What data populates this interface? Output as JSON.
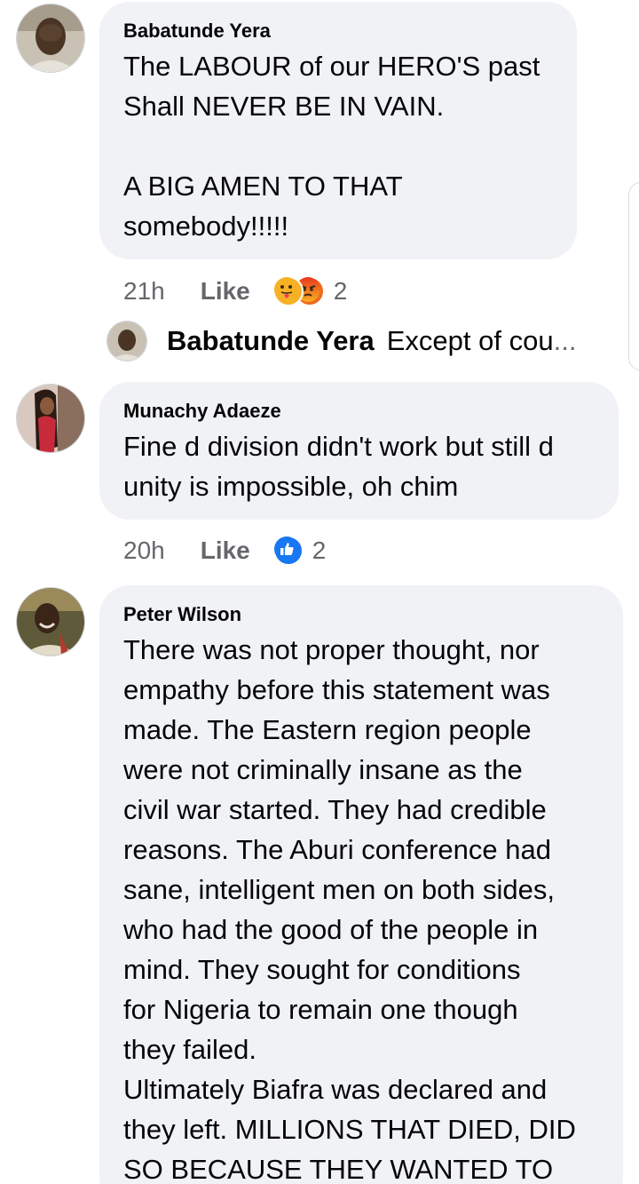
{
  "comments": [
    {
      "author": "Babatunde Yera",
      "text": "The LABOUR of our HERO'S past\nShall NEVER BE IN VAIN.\n\nA BIG AMEN TO THAT\nsomebody!!!!!",
      "time": "21h",
      "like_label": "Like",
      "reactions": [
        "love-care-icon",
        "angry-icon"
      ],
      "reaction_count": "2",
      "reply_preview": {
        "author": "Babatunde Yera",
        "text": "Except of cou",
        "ellipsis": "..."
      }
    },
    {
      "author": "Munachy Adaeze",
      "text": "Fine d division didn't work but still d\nunity is impossible, oh chim",
      "time": "20h",
      "like_label": "Like",
      "reactions": [
        "like-icon"
      ],
      "reaction_count": "2"
    },
    {
      "author": "Peter Wilson",
      "text": "There was not proper thought, nor\nempathy before this statement was\nmade. The Eastern region people\nwere not criminally insane as the\ncivil war started. They had credible\nreasons. The Aburi conference had\nsane, intelligent men on both sides,\nwho had the good of the people in\nmind. They sought for conditions\nfor Nigeria to remain one though\nthey failed.\nUltimately Biafra was declared and\nthey left. MILLIONS THAT DIED, DID\nSO BECAUSE THEY WANTED TO"
    }
  ],
  "colors": {
    "bubble": "#f0f2f5",
    "meta": "#65676b",
    "like_blue": "#1877f2",
    "angry": "#f06a1d",
    "love_yellow": "#f7b125"
  }
}
